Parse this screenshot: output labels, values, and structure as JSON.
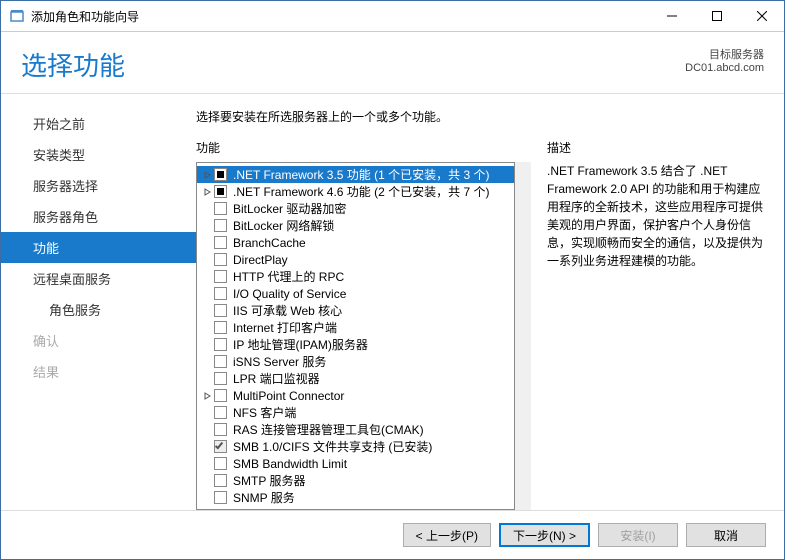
{
  "window": {
    "title": "添加角色和功能向导"
  },
  "header": {
    "heading": "选择功能",
    "target_label": "目标服务器",
    "target_value": "DC01.abcd.com"
  },
  "sidebar": {
    "items": [
      {
        "label": "开始之前",
        "state": "normal"
      },
      {
        "label": "安装类型",
        "state": "normal"
      },
      {
        "label": "服务器选择",
        "state": "normal"
      },
      {
        "label": "服务器角色",
        "state": "normal"
      },
      {
        "label": "功能",
        "state": "selected"
      },
      {
        "label": "远程桌面服务",
        "state": "normal"
      },
      {
        "label": "角色服务",
        "state": "normal",
        "sub": true
      },
      {
        "label": "确认",
        "state": "dim"
      },
      {
        "label": "结果",
        "state": "dim"
      }
    ]
  },
  "main": {
    "instruction": "选择要安装在所选服务器上的一个或多个功能。",
    "features_label": "功能",
    "description_label": "描述",
    "features_items": [
      {
        "label": ".NET Framework 3.5 功能 (1 个已安装，共 3 个)",
        "check": "indeterminate",
        "expandable": true,
        "selected": true
      },
      {
        "label": ".NET Framework 4.6 功能 (2 个已安装，共 7 个)",
        "check": "indeterminate",
        "expandable": true
      },
      {
        "label": "BitLocker 驱动器加密",
        "check": "none"
      },
      {
        "label": "BitLocker 网络解锁",
        "check": "none"
      },
      {
        "label": "BranchCache",
        "check": "none"
      },
      {
        "label": "DirectPlay",
        "check": "none"
      },
      {
        "label": "HTTP 代理上的 RPC",
        "check": "none"
      },
      {
        "label": "I/O Quality of Service",
        "check": "none"
      },
      {
        "label": "IIS 可承载 Web 核心",
        "check": "none"
      },
      {
        "label": "Internet 打印客户端",
        "check": "none"
      },
      {
        "label": "IP 地址管理(IPAM)服务器",
        "check": "none"
      },
      {
        "label": "iSNS Server 服务",
        "check": "none"
      },
      {
        "label": "LPR 端口监视器",
        "check": "none"
      },
      {
        "label": "MultiPoint Connector",
        "check": "none",
        "expandable": true
      },
      {
        "label": "NFS 客户端",
        "check": "none"
      },
      {
        "label": "RAS 连接管理器管理工具包(CMAK)",
        "check": "none"
      },
      {
        "label": "SMB 1.0/CIFS 文件共享支持 (已安装)",
        "check": "checked"
      },
      {
        "label": "SMB Bandwidth Limit",
        "check": "none"
      },
      {
        "label": "SMTP 服务器",
        "check": "none"
      },
      {
        "label": "SNMP 服务",
        "check": "none"
      }
    ],
    "description_text": ".NET Framework 3.5 结合了 .NET Framework 2.0 API 的功能和用于构建应用程序的全新技术，这些应用程序可提供美观的用户界面，保护客户个人身份信息，实现顺畅而安全的通信，以及提供为一系列业务进程建模的功能。"
  },
  "footer": {
    "prev": "< 上一步(P)",
    "next": "下一步(N) >",
    "install": "安装(I)",
    "cancel": "取消"
  }
}
